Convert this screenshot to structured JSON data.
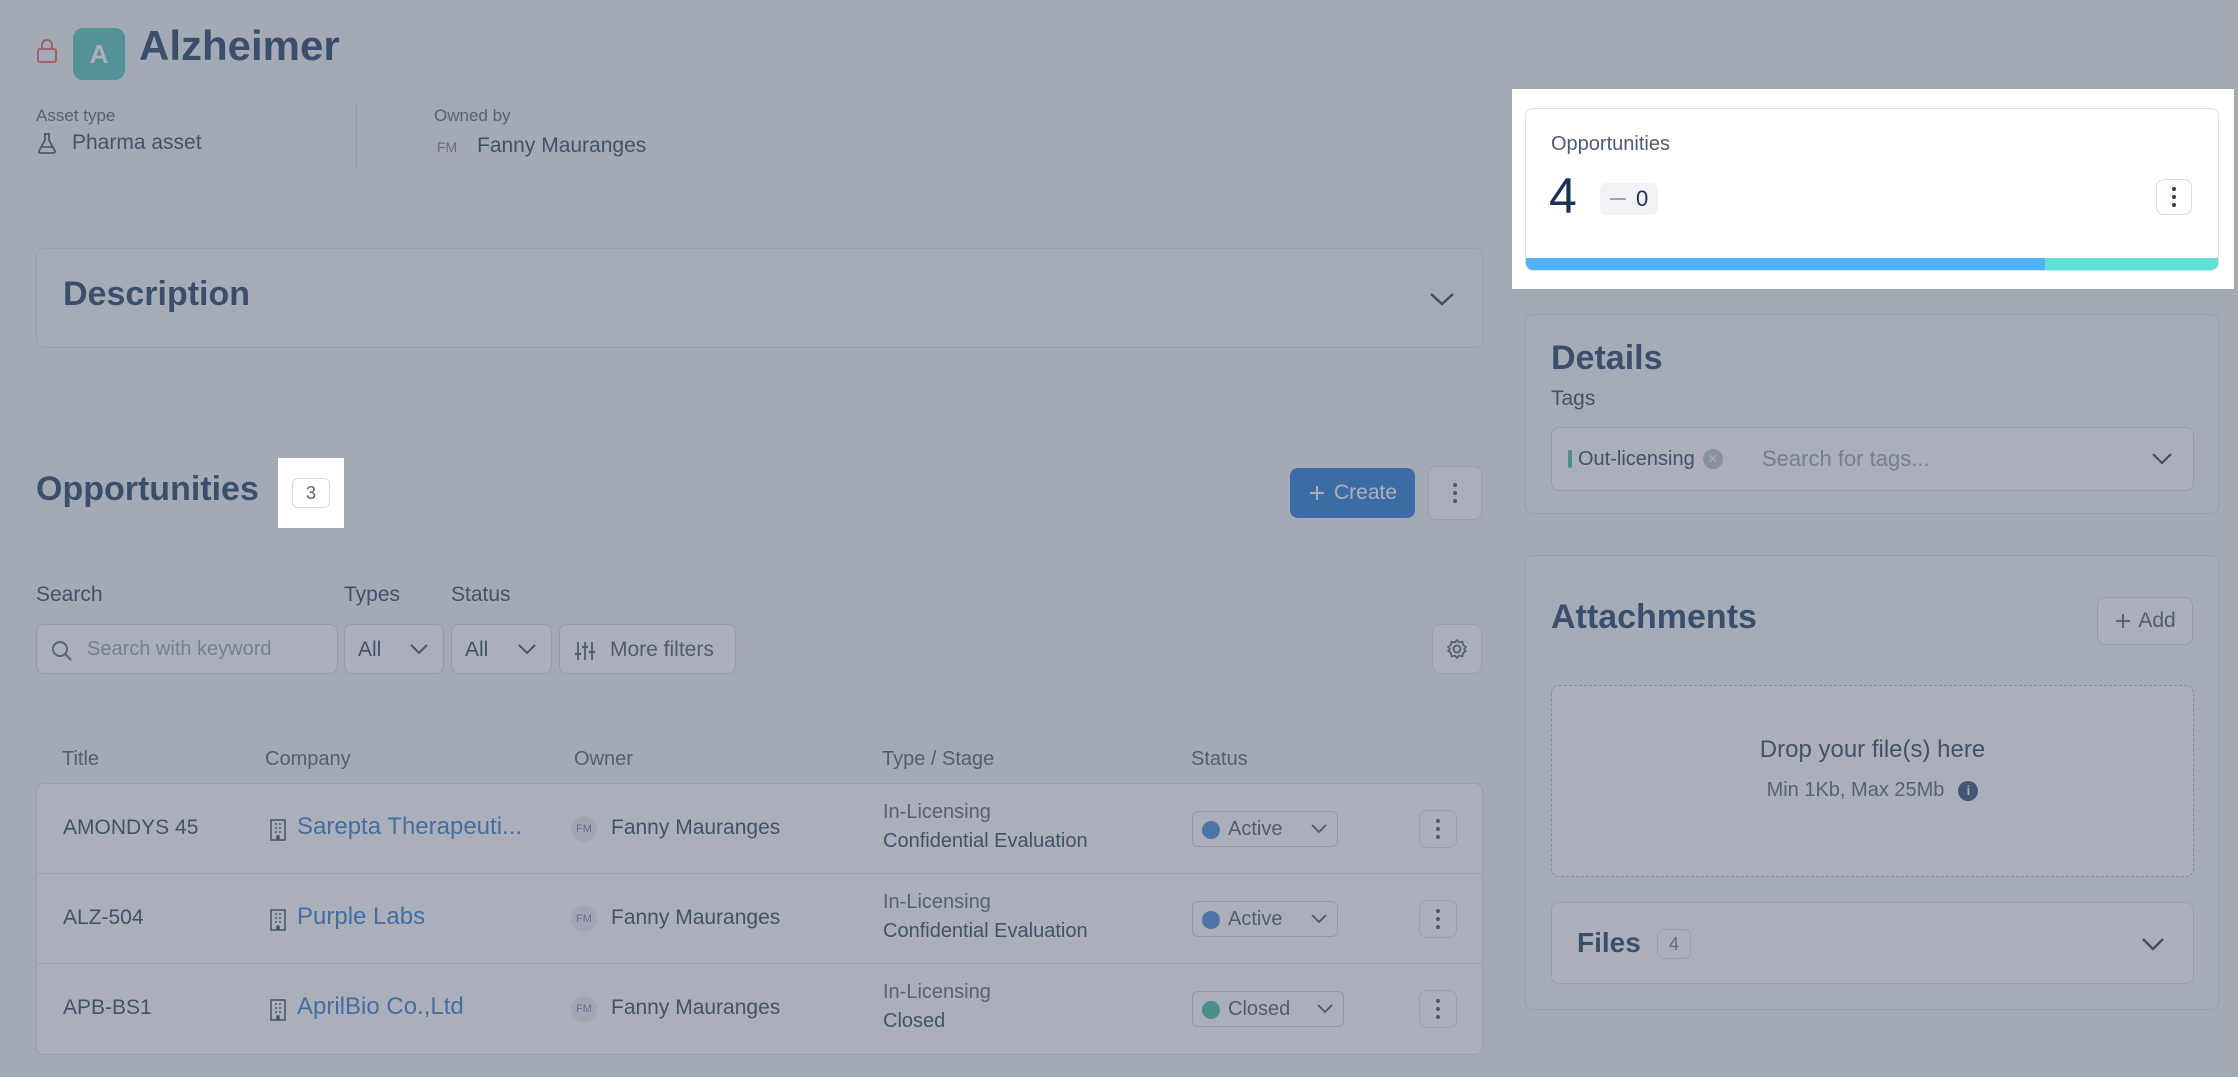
{
  "asset": {
    "avatar_letter": "A",
    "title": "Alzheimer",
    "asset_type_label": "Asset type",
    "asset_type_value": "Pharma asset",
    "owned_by_label": "Owned by",
    "owner_initials": "FM",
    "owner_name": "Fanny Mauranges"
  },
  "description": {
    "title": "Description"
  },
  "opportunities": {
    "title": "Opportunities",
    "count": "3",
    "create_label": "Create",
    "filters": {
      "search_label": "Search",
      "search_placeholder": "Search with keyword",
      "types_label": "Types",
      "types_value": "All",
      "status_label": "Status",
      "status_value": "All",
      "more_filters_label": "More filters"
    },
    "columns": [
      "Title",
      "Company",
      "Owner",
      "Type / Stage",
      "Status"
    ],
    "rows": [
      {
        "title": "AMONDYS 45",
        "company": "Sarepta Therapeuti...",
        "owner_initials": "FM",
        "owner": "Fanny Mauranges",
        "type": "In-Licensing",
        "stage": "Confidential Evaluation",
        "status": "Active"
      },
      {
        "title": "ALZ-504",
        "company": "Purple Labs",
        "owner_initials": "FM",
        "owner": "Fanny Mauranges",
        "type": "In-Licensing",
        "stage": "Confidential Evaluation",
        "status": "Active"
      },
      {
        "title": "APB-BS1",
        "company": "AprilBio Co.,Ltd",
        "owner_initials": "FM",
        "owner": "Fanny Mauranges",
        "type": "In-Licensing",
        "stage": "Closed",
        "status": "Closed"
      }
    ]
  },
  "opportunities_widget": {
    "label": "Opportunities",
    "value": "4",
    "delta": "0",
    "bar_fraction_primary": 0.75
  },
  "details": {
    "title": "Details",
    "tags_label": "Tags",
    "tag": "Out-licensing",
    "tags_placeholder": "Search for tags..."
  },
  "attachments": {
    "title": "Attachments",
    "add_label": "Add",
    "drop_title": "Drop your file(s) here",
    "drop_sub": "Min 1Kb, Max 25Mb",
    "info_glyph": "i",
    "files_label": "Files",
    "files_count": "4"
  },
  "colors": {
    "accent": "#0a6bd6",
    "brand_teal": "#3fc2b6",
    "status_active": "#2f7fd6",
    "status_closed": "#2cb7a3",
    "bar_primary": "#4fb3f5",
    "bar_secondary": "#5fe0d6"
  },
  "icons": {
    "lock": "lock-icon",
    "flask": "flask-icon",
    "building": "building-icon",
    "search": "search-icon",
    "sliders": "sliders-icon",
    "gear": "gear-icon",
    "chevron": "chevron-down-icon",
    "kebab": "kebab-icon",
    "plus": "plus-icon",
    "info": "info-icon"
  }
}
